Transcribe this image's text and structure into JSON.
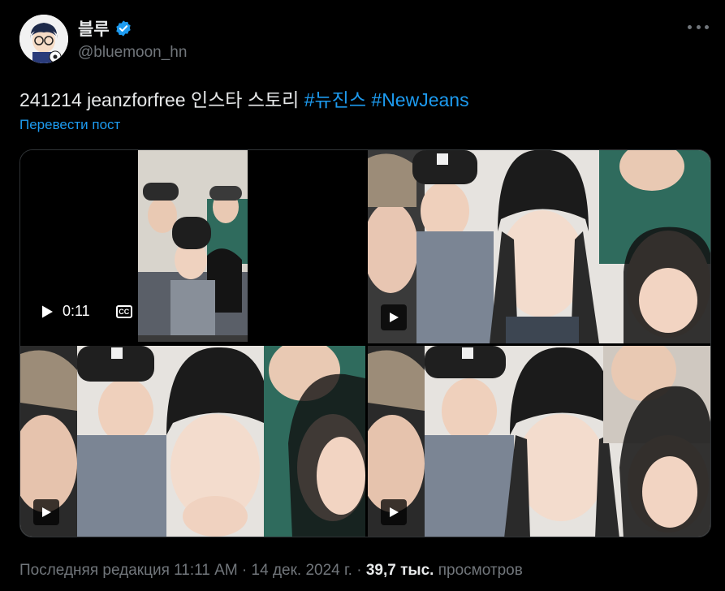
{
  "author": {
    "display_name": "블루",
    "handle": "@bluemoon_hn",
    "verified": true,
    "avatar_icon": "anime-avatar"
  },
  "tweet": {
    "text_plain": "241214 jeanzforfree 인스타 스토리 ",
    "hashtags": [
      "#뉴진스",
      "#NewJeans"
    ],
    "translate_label": "Перевести пост"
  },
  "media": {
    "video_duration": "0:11",
    "cc_label": "CC"
  },
  "meta": {
    "edited_label": "Последняя редакция 11:11 AM",
    "date": "14 дек. 2024 г.",
    "views_count": "39,7 тыс.",
    "views_label": "просмотров"
  },
  "colors": {
    "accent": "#1d9bf0",
    "text": "#e7e9ea",
    "secondary": "#71767b"
  }
}
